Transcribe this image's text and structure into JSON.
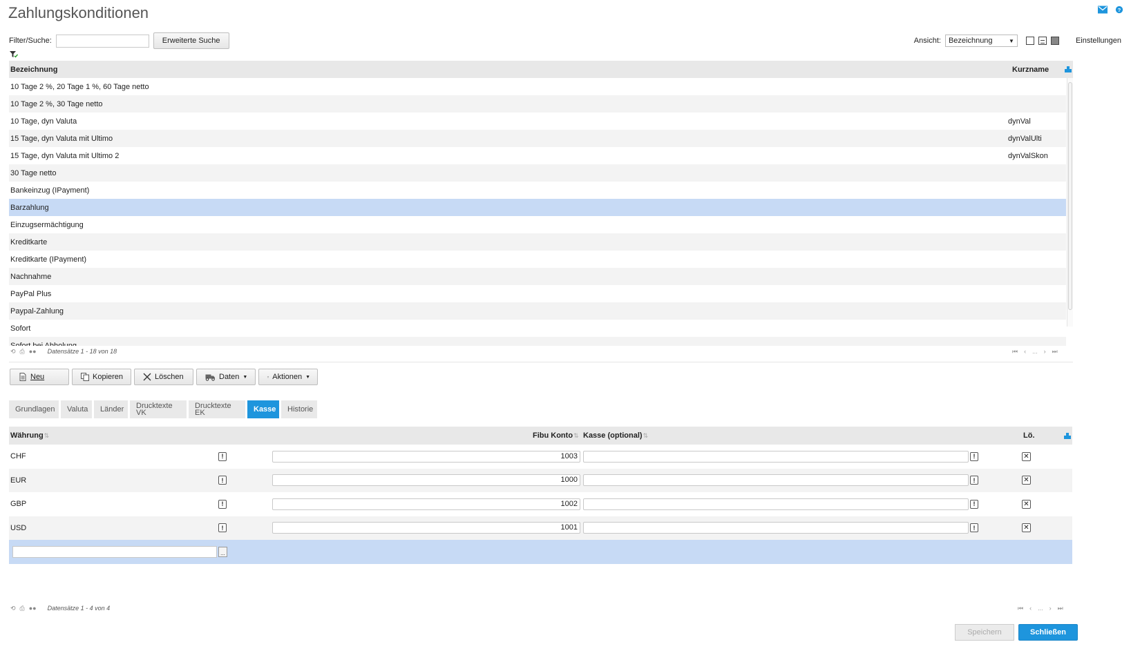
{
  "page": {
    "title": "Zahlungskonditionen"
  },
  "filter": {
    "label": "Filter/Suche:",
    "value": "",
    "extended_search_label": "Erweiterte Suche",
    "view_label": "Ansicht:",
    "view_selected": "Bezeichnung",
    "settings_label": "Einstellungen"
  },
  "main_grid": {
    "headers": {
      "bezeichnung": "Bezeichnung",
      "kurzname": "Kurzname"
    },
    "rows": [
      {
        "bezeichnung": "10 Tage 2 %, 20 Tage 1 %, 60 Tage netto",
        "kurzname": ""
      },
      {
        "bezeichnung": "10 Tage 2 %, 30 Tage netto",
        "kurzname": ""
      },
      {
        "bezeichnung": "10 Tage, dyn Valuta",
        "kurzname": "dynVal"
      },
      {
        "bezeichnung": "15 Tage, dyn Valuta mit Ultimo",
        "kurzname": "dynValUlti"
      },
      {
        "bezeichnung": "15 Tage, dyn Valuta mit Ultimo 2",
        "kurzname": "dynValSkon"
      },
      {
        "bezeichnung": "30 Tage netto",
        "kurzname": ""
      },
      {
        "bezeichnung": "Bankeinzug (IPayment)",
        "kurzname": ""
      },
      {
        "bezeichnung": "Barzahlung",
        "kurzname": "",
        "selected": true
      },
      {
        "bezeichnung": "Einzugsermächtigung",
        "kurzname": ""
      },
      {
        "bezeichnung": "Kreditkarte",
        "kurzname": ""
      },
      {
        "bezeichnung": "Kreditkarte (IPayment)",
        "kurzname": ""
      },
      {
        "bezeichnung": "Nachnahme",
        "kurzname": ""
      },
      {
        "bezeichnung": "PayPal Plus",
        "kurzname": ""
      },
      {
        "bezeichnung": "Paypal-Zahlung",
        "kurzname": ""
      },
      {
        "bezeichnung": "Sofort",
        "kurzname": ""
      },
      {
        "bezeichnung": "Sofort bei Abholung",
        "kurzname": ""
      }
    ],
    "pager_text": "Datensätze 1 - 18 von 18",
    "pager_ellipsis": "..."
  },
  "toolbar": {
    "new_label": "Neu",
    "copy_label": "Kopieren",
    "delete_label": "Löschen",
    "data_label": "Daten",
    "actions_label": "Aktionen"
  },
  "tabs": [
    {
      "label": "Grundlagen"
    },
    {
      "label": "Valuta"
    },
    {
      "label": "Länder"
    },
    {
      "label": "Drucktexte VK"
    },
    {
      "label": "Drucktexte EK"
    },
    {
      "label": "Kasse",
      "active": true
    },
    {
      "label": "Historie"
    }
  ],
  "kasse_grid": {
    "headers": {
      "waehrung": "Währung",
      "fibu_konto": "Fibu Konto",
      "kasse": "Kasse (optional)",
      "loeschen": "Lö."
    },
    "rows": [
      {
        "waehrung": "CHF",
        "fibu_konto": "1003",
        "kasse": ""
      },
      {
        "waehrung": "EUR",
        "fibu_konto": "1000",
        "kasse": ""
      },
      {
        "waehrung": "GBP",
        "fibu_konto": "1002",
        "kasse": ""
      },
      {
        "waehrung": "USD",
        "fibu_konto": "1001",
        "kasse": ""
      }
    ],
    "new_row_value": "",
    "pager_text": "Datensätze 1 - 4 von 4",
    "pager_ellipsis": "..."
  },
  "footer": {
    "save_label": "Speichern",
    "close_label": "Schließen"
  },
  "colors": {
    "accent": "#1e95dd",
    "selected_row": "#c7daf5",
    "header_bg": "#e8e8e8"
  }
}
